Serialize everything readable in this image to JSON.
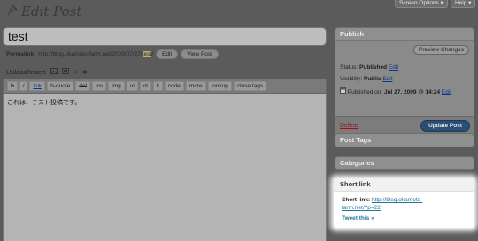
{
  "header": {
    "screen_options_label": "Screen Options ▾",
    "help_label": "Help ▾",
    "page_title": "Edit Post"
  },
  "post": {
    "title": "test",
    "permalink_label": "Permalink:",
    "permalink_url": "http://blog.okamoto-farm.net/2009/07/27/",
    "permalink_slug": "test",
    "permalink_end": "/",
    "edit_label": "Edit",
    "view_post_label": "View Post"
  },
  "upload": {
    "label": "Upload/Insert",
    "icons": [
      "image-icon",
      "media-icon",
      "audio-icon",
      "gear-icon"
    ]
  },
  "toolbar": {
    "buttons": [
      "b",
      "i",
      "link",
      "b-quote",
      "del",
      "ins",
      "img",
      "ul",
      "ol",
      "li",
      "code",
      "more",
      "lookup",
      "close tags"
    ]
  },
  "editor": {
    "content": "これは、テスト投稿です。"
  },
  "publish_box": {
    "title": "Publish",
    "preview_label": "Preview Changes",
    "status_label": "Status:",
    "status_value": "Published",
    "status_edit": "Edit",
    "visibility_label": "Visibility:",
    "visibility_value": "Public",
    "visibility_edit": "Edit",
    "published_label": "Published on:",
    "published_value": "Jul 27, 2009 @ 14:24",
    "published_edit": "Edit",
    "delete_label": "Delete",
    "update_label": "Update Post"
  },
  "post_tags_box": {
    "title": "Post Tags"
  },
  "categories_box": {
    "title": "Categories"
  },
  "shortlink_box": {
    "title": "Short link",
    "label": "Short link:",
    "url_line1": "http://blog.okamoto-",
    "url_line2": "farm.net/?p=22",
    "tweet_label": "Tweet this »"
  }
}
